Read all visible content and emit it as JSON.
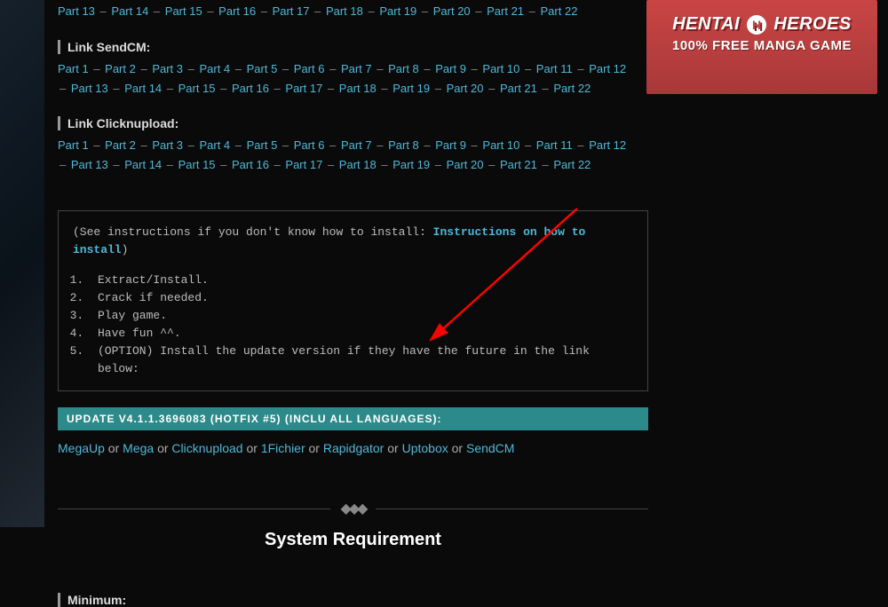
{
  "topParts": [
    "Part 13",
    "Part 14",
    "Part 15",
    "Part 16",
    "Part 17",
    "Part 18",
    "Part 19",
    "Part 20",
    "Part 21",
    "Part 22"
  ],
  "sendcm": {
    "label": "Link SendCM:",
    "row1": [
      "Part 1",
      "Part 2",
      "Part 3",
      "Part 4",
      "Part 5",
      "Part 6",
      "Part 7",
      "Part 8",
      "Part 9",
      "Part 10",
      "Part 11",
      "Part 12"
    ],
    "row2": [
      "Part 13",
      "Part 14",
      "Part 15",
      "Part 16",
      "Part 17",
      "Part 18",
      "Part 19",
      "Part 20",
      "Part 21",
      "Part 22"
    ]
  },
  "clicknupload": {
    "label": "Link Clicknupload:",
    "row1": [
      "Part 1",
      "Part 2",
      "Part 3",
      "Part 4",
      "Part 5",
      "Part 6",
      "Part 7",
      "Part 8",
      "Part 9",
      "Part 10",
      "Part 11",
      "Part 12"
    ],
    "row2": [
      "Part 13",
      "Part 14",
      "Part 15",
      "Part 16",
      "Part 17",
      "Part 18",
      "Part 19",
      "Part 20",
      "Part 21",
      "Part 22"
    ]
  },
  "instructions": {
    "prefix": "(See instructions if you don't know how to install: ",
    "link": "Instructions on how to install",
    "suffix": ")",
    "steps": [
      "Extract/Install.",
      "Crack if needed.",
      "Play game.",
      "Have fun ^^.",
      "(OPTION) Install the update version if they have the future in the link below:"
    ]
  },
  "update": {
    "banner": "UPDATE V4.1.1.3696083 (HOTFIX #5) (INCLU ALL LANGUAGES):",
    "links": [
      "MegaUp",
      "Mega",
      "Clicknupload",
      "1Fichier",
      "Rapidgator",
      "Uptobox",
      "SendCM"
    ],
    "or": " or "
  },
  "sysReq": {
    "heading": "System Requirement",
    "minimum": "Minimum:"
  },
  "ad": {
    "title1": "HENTAI",
    "title2": "HEROES",
    "sub": "100% FREE MANGA GAME"
  }
}
